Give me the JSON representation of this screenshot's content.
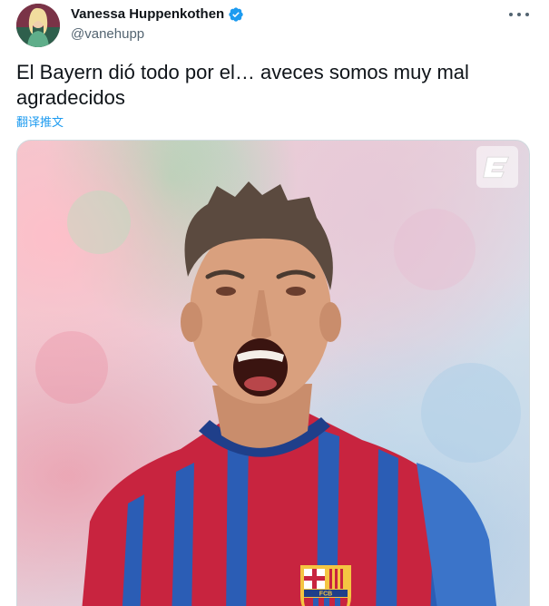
{
  "author": {
    "display_name": "Vanessa Huppenkothen",
    "handle": "@vanehupp",
    "verified": true,
    "verified_color": "#1d9bf0"
  },
  "tweet": {
    "text": "El Bayern dió todo por el… aveces somos muy mal agradecidos",
    "translate_label": "翻译推文"
  },
  "media": {
    "watermark_icon": "espn-e-logo",
    "crest_text": "FCB"
  },
  "icons": {
    "more": "more-horizontal-icon",
    "verified": "verified-badge-icon"
  },
  "colors": {
    "link": "#1d9bf0",
    "secondary_text": "#536471",
    "jersey_red": "#c8243f",
    "jersey_blue": "#2b5db5"
  }
}
